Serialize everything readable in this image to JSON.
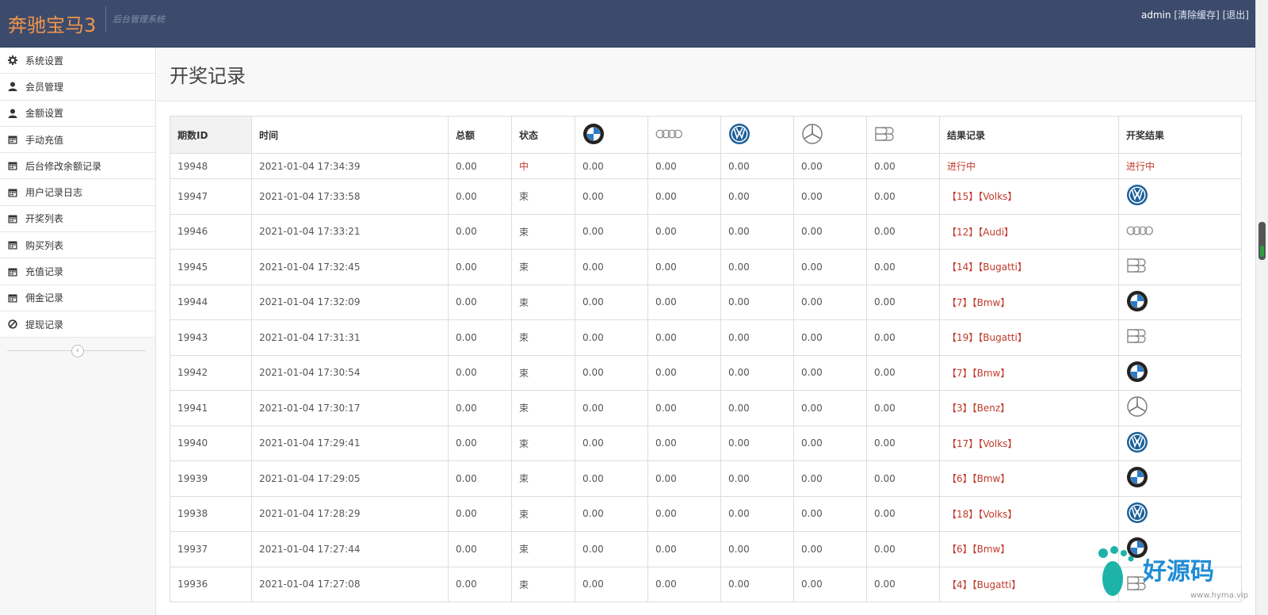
{
  "header": {
    "brand": "奔驰宝马3",
    "subtitle": "后台管理系统",
    "user": "admin",
    "clear_cache": "[清除缓存]",
    "logout": "[退出]"
  },
  "sidebar": {
    "items": [
      {
        "label": "系统设置",
        "icon": "gear-icon"
      },
      {
        "label": "会员管理",
        "icon": "user-icon"
      },
      {
        "label": "金额设置",
        "icon": "user-icon"
      },
      {
        "label": "手动充值",
        "icon": "calendar-icon"
      },
      {
        "label": "后台修改余额记录",
        "icon": "calendar-icon"
      },
      {
        "label": "用户记录日志",
        "icon": "calendar-icon"
      },
      {
        "label": "开奖列表",
        "icon": "calendar-icon"
      },
      {
        "label": "购买列表",
        "icon": "calendar-icon"
      },
      {
        "label": "充值记录",
        "icon": "calendar-icon"
      },
      {
        "label": "佣金记录",
        "icon": "calendar-icon"
      },
      {
        "label": "提现记录",
        "icon": "ban-icon"
      }
    ],
    "collapse": "‹"
  },
  "page": {
    "title": "开奖记录"
  },
  "table": {
    "headers": {
      "id": "期数ID",
      "time": "时间",
      "total": "总额",
      "status": "状态",
      "result_record": "结果记录",
      "draw_result": "开奖结果"
    },
    "brand_columns": [
      "bmw",
      "audi",
      "volks",
      "benz",
      "bugatti"
    ],
    "rows": [
      {
        "id": "19948",
        "time": "2021-01-04 17:34:39",
        "total": "0.00",
        "status": "中",
        "v1": "0.00",
        "v2": "0.00",
        "v3": "0.00",
        "v4": "0.00",
        "v5": "0.00",
        "record": "进行中",
        "result": "进行中",
        "result_logo": ""
      },
      {
        "id": "19947",
        "time": "2021-01-04 17:33:58",
        "total": "0.00",
        "status": "束",
        "v1": "0.00",
        "v2": "0.00",
        "v3": "0.00",
        "v4": "0.00",
        "v5": "0.00",
        "record": "【15】【Volks】",
        "result": "",
        "result_logo": "volks"
      },
      {
        "id": "19946",
        "time": "2021-01-04 17:33:21",
        "total": "0.00",
        "status": "束",
        "v1": "0.00",
        "v2": "0.00",
        "v3": "0.00",
        "v4": "0.00",
        "v5": "0.00",
        "record": "【12】【Audi】",
        "result": "",
        "result_logo": "audi"
      },
      {
        "id": "19945",
        "time": "2021-01-04 17:32:45",
        "total": "0.00",
        "status": "束",
        "v1": "0.00",
        "v2": "0.00",
        "v3": "0.00",
        "v4": "0.00",
        "v5": "0.00",
        "record": "【14】【Bugatti】",
        "result": "",
        "result_logo": "bugatti"
      },
      {
        "id": "19944",
        "time": "2021-01-04 17:32:09",
        "total": "0.00",
        "status": "束",
        "v1": "0.00",
        "v2": "0.00",
        "v3": "0.00",
        "v4": "0.00",
        "v5": "0.00",
        "record": "【7】【Bmw】",
        "result": "",
        "result_logo": "bmw"
      },
      {
        "id": "19943",
        "time": "2021-01-04 17:31:31",
        "total": "0.00",
        "status": "束",
        "v1": "0.00",
        "v2": "0.00",
        "v3": "0.00",
        "v4": "0.00",
        "v5": "0.00",
        "record": "【19】【Bugatti】",
        "result": "",
        "result_logo": "bugatti"
      },
      {
        "id": "19942",
        "time": "2021-01-04 17:30:54",
        "total": "0.00",
        "status": "束",
        "v1": "0.00",
        "v2": "0.00",
        "v3": "0.00",
        "v4": "0.00",
        "v5": "0.00",
        "record": "【7】【Bmw】",
        "result": "",
        "result_logo": "bmw"
      },
      {
        "id": "19941",
        "time": "2021-01-04 17:30:17",
        "total": "0.00",
        "status": "束",
        "v1": "0.00",
        "v2": "0.00",
        "v3": "0.00",
        "v4": "0.00",
        "v5": "0.00",
        "record": "【3】【Benz】",
        "result": "",
        "result_logo": "benz"
      },
      {
        "id": "19940",
        "time": "2021-01-04 17:29:41",
        "total": "0.00",
        "status": "束",
        "v1": "0.00",
        "v2": "0.00",
        "v3": "0.00",
        "v4": "0.00",
        "v5": "0.00",
        "record": "【17】【Volks】",
        "result": "",
        "result_logo": "volks"
      },
      {
        "id": "19939",
        "time": "2021-01-04 17:29:05",
        "total": "0.00",
        "status": "束",
        "v1": "0.00",
        "v2": "0.00",
        "v3": "0.00",
        "v4": "0.00",
        "v5": "0.00",
        "record": "【6】【Bmw】",
        "result": "",
        "result_logo": "bmw"
      },
      {
        "id": "19938",
        "time": "2021-01-04 17:28:29",
        "total": "0.00",
        "status": "束",
        "v1": "0.00",
        "v2": "0.00",
        "v3": "0.00",
        "v4": "0.00",
        "v5": "0.00",
        "record": "【18】【Volks】",
        "result": "",
        "result_logo": "volks"
      },
      {
        "id": "19937",
        "time": "2021-01-04 17:27:44",
        "total": "0.00",
        "status": "束",
        "v1": "0.00",
        "v2": "0.00",
        "v3": "0.00",
        "v4": "0.00",
        "v5": "0.00",
        "record": "【6】【Bmw】",
        "result": "",
        "result_logo": "bmw"
      },
      {
        "id": "19936",
        "time": "2021-01-04 17:27:08",
        "total": "0.00",
        "status": "束",
        "v1": "0.00",
        "v2": "0.00",
        "v3": "0.00",
        "v4": "0.00",
        "v5": "0.00",
        "record": "【4】【Bugatti】",
        "result": "",
        "result_logo": "bugatti"
      }
    ]
  },
  "watermark": {
    "text": "好源码",
    "url": "www.hyma.vip"
  },
  "colors": {
    "header_bg": "#3c4b6b",
    "brand": "#f0954a",
    "status_red": "#c0392b"
  }
}
